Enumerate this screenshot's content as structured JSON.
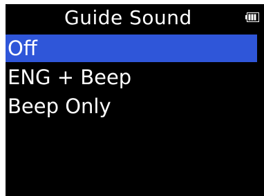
{
  "header": {
    "title": "Guide Sound",
    "battery_icon": "battery-icon"
  },
  "menu": {
    "items": [
      {
        "label": "Off",
        "selected": true
      },
      {
        "label": "ENG + Beep",
        "selected": false
      },
      {
        "label": "Beep Only",
        "selected": false
      }
    ]
  },
  "colors": {
    "background": "#000000",
    "text": "#ffffff",
    "selection": "#2f56d9"
  }
}
